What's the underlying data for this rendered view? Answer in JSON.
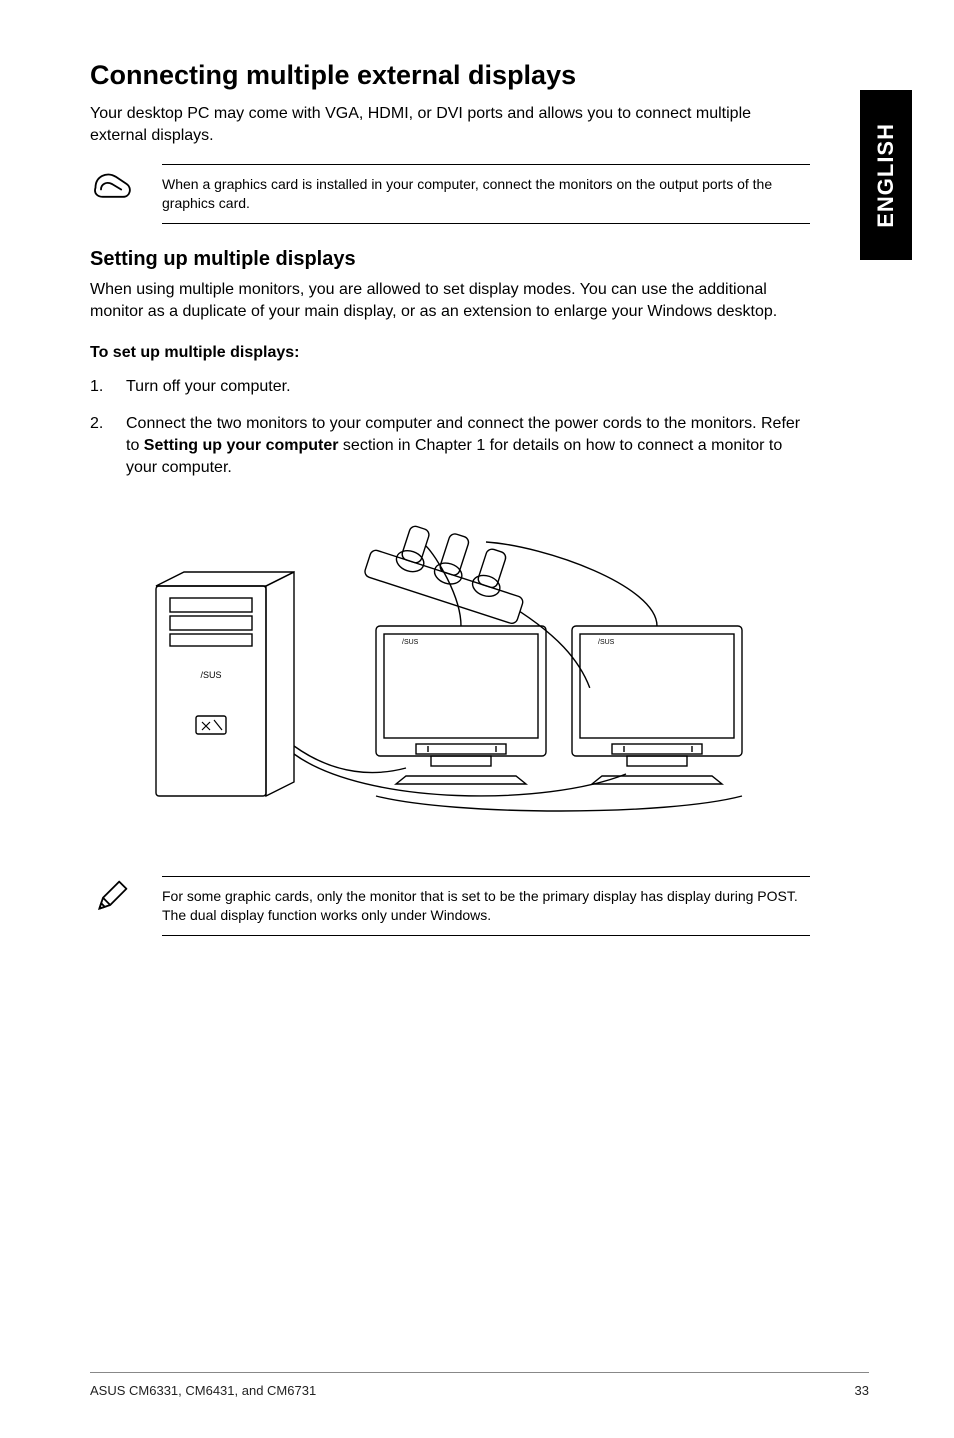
{
  "sidebar": {
    "lang": "ENGLISH"
  },
  "title": "Connecting multiple external displays",
  "intro": "Your desktop PC may come with VGA, HDMI, or DVI ports and allows you to connect multiple external displays.",
  "note1": "When a graphics card is installed in your computer, connect the monitors on the output ports of the graphics card.",
  "heading2": "Setting up multiple displays",
  "subintro": "When using multiple monitors, you are allowed to set display modes. You can use the additional monitor as a duplicate of your main display, or as an extension to enlarge your Windows desktop.",
  "steps_title": "To set up multiple displays:",
  "steps": [
    {
      "num": "1.",
      "body_pre": "Turn off your computer.",
      "bold": "",
      "body_post": ""
    },
    {
      "num": "2.",
      "body_pre": "Connect the two monitors to your computer and connect the power cords to the monitors. Refer to ",
      "bold": "Setting up your computer",
      "body_post": " section in Chapter 1 for details on how to connect a monitor to your computer."
    }
  ],
  "note2": "For some graphic cards, only the monitor that is set to be the primary display has display during POST. The dual display function works only under Windows.",
  "footer": {
    "left": "ASUS CM6331, CM6431, and CM6731",
    "right": "33"
  },
  "icons": {
    "paperclip": "paperclip-icon",
    "pencil": "pencil-icon"
  }
}
